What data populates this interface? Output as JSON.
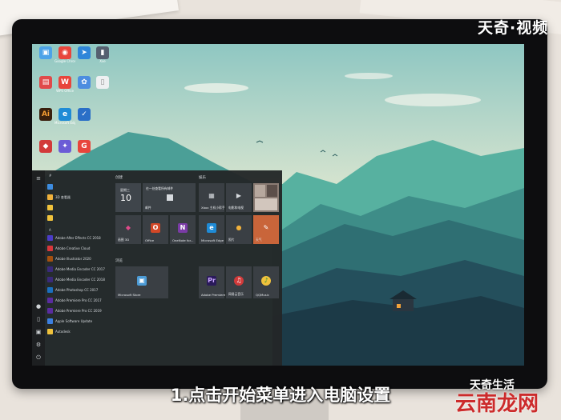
{
  "watermarks": {
    "top_right": "天奇·视频",
    "caption": "1.点击开始菜单进入电脑设置",
    "brand_small": "天奇生活",
    "brand_large": "云南龙网"
  },
  "desktop_icons": [
    {
      "label": "",
      "glyph": "▣",
      "color": "#4da3e8"
    },
    {
      "label": "Google Chrome",
      "glyph": "◉",
      "color": "#e8453c"
    },
    {
      "label": "",
      "glyph": "➤",
      "color": "#2f86d9"
    },
    {
      "label": "Xxe",
      "glyph": "▮",
      "color": "#556070"
    },
    {
      "label": "",
      "glyph": "▤",
      "color": "#e04a4a"
    },
    {
      "label": "WPS Office",
      "glyph": "W",
      "color": "#e8453c"
    },
    {
      "label": "",
      "glyph": "✿",
      "color": "#4c8de0"
    },
    {
      "label": "",
      "glyph": "▯",
      "color": "#eef0f2"
    },
    {
      "label": "",
      "glyph": "Ai",
      "color": "#3a1f0d"
    },
    {
      "label": "Microsoft Edge",
      "glyph": "e",
      "color": "#1f8bd6"
    },
    {
      "label": "",
      "glyph": "✓",
      "color": "#2a6fc7"
    },
    {
      "label": "",
      "glyph": "◆",
      "color": "#d23a3a"
    },
    {
      "label": "",
      "glyph": "✦",
      "color": "#6b5cd6"
    },
    {
      "label": "",
      "glyph": "G",
      "color": "#e8453c"
    }
  ],
  "start_menu": {
    "left_letters": [
      "#",
      "A"
    ],
    "apps": [
      {
        "name": "",
        "color": "#3d8ce0"
      },
      {
        "name": "3D 查看器",
        "color": "#f0b13c"
      },
      {
        "name": "",
        "color": "#f0c23c"
      },
      {
        "name": "",
        "color": "#f0c23c"
      },
      {
        "name": "Adobe After Effects CC 2018",
        "color": "#4b3cc7"
      },
      {
        "name": "Adobe Creative Cloud",
        "color": "#d7373b"
      },
      {
        "name": "Adobe Illustrator 2020",
        "color": "#a45010"
      },
      {
        "name": "Adobe Media Encoder CC 2017",
        "color": "#3a2a7a"
      },
      {
        "name": "Adobe Media Encoder CC 2018",
        "color": "#3a2a7a"
      },
      {
        "name": "Adobe Photoshop CC 2017",
        "color": "#1b6fbf"
      },
      {
        "name": "Adobe Premiere Pro CC 2017",
        "color": "#5a2ca0"
      },
      {
        "name": "Adobe Premiere Pro CC 2019",
        "color": "#5a2ca0"
      },
      {
        "name": "Apple Software Update",
        "color": "#3c7fe0"
      },
      {
        "name": "Autodesk",
        "color": "#f0c23c"
      }
    ],
    "section_left": "创建",
    "section_right": "娱乐",
    "section_bottom": "浏览",
    "tiles": {
      "calendar_day": "星期三",
      "calendar_num": "10",
      "mail_label": "邮件",
      "mail_title": "在一处查看所有邮件",
      "tiles_row2": [
        "画图 3D",
        "Office",
        "OneNote for...",
        "Microsoft Edge",
        "照片",
        "天气"
      ],
      "xbox_label": "Xbox 主机小帮手",
      "movies_label": "电影和电视",
      "store_label": "Microsoft Store",
      "premiere_label": "Adobe Premiere Pro...",
      "netease_label": "网易云音乐",
      "qq_label": "QQMusic"
    }
  }
}
